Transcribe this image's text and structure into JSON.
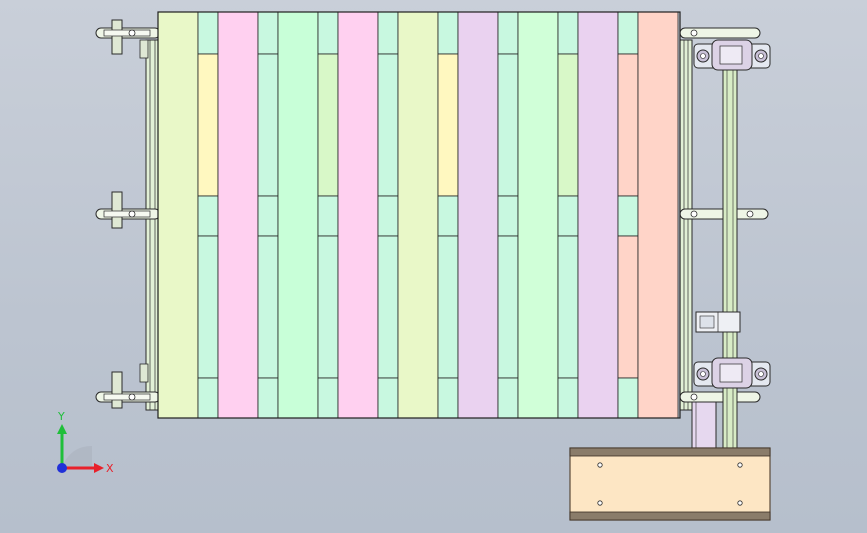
{
  "view": {
    "background_top": "#c9cfd9",
    "background_bottom": "#b6bfcc"
  },
  "triad": {
    "x_label": "X",
    "y_label": "Y",
    "x_color": "#e8202a",
    "y_color": "#1fbf3a",
    "z_color": "#2030d8"
  },
  "slats": {
    "colors": [
      "#e9f8c8",
      "#ffd0f0",
      "#c8ffd8",
      "#ffd0f0",
      "#e9f8c8",
      "#ead2f0",
      "#d0ffd8",
      "#ead2f0",
      "#ffd4c8"
    ],
    "gap_colors_top": [
      "#c8f8e0",
      "#c8f8e0",
      "#c8f8e0",
      "#c8f8e0",
      "#c8f8e0",
      "#c8f8e0",
      "#c8f8e0",
      "#c8f8e0"
    ],
    "gap_colors_mid": [
      "#fff8c0",
      "#c8f8e0",
      "#d8f8c8",
      "#c8f8e0",
      "#fff8c0",
      "#c8f8e0",
      "#d8f8c8",
      "#ffd4c8"
    ]
  },
  "part_colors": {
    "frame_line": "#2a2a2a",
    "rail": "#e2f0d6",
    "shaft": "#d8ecc6",
    "bearing": "#dcd2e6",
    "motor_body": "#fde6c4",
    "motor_edge": "#5a4a3a"
  }
}
